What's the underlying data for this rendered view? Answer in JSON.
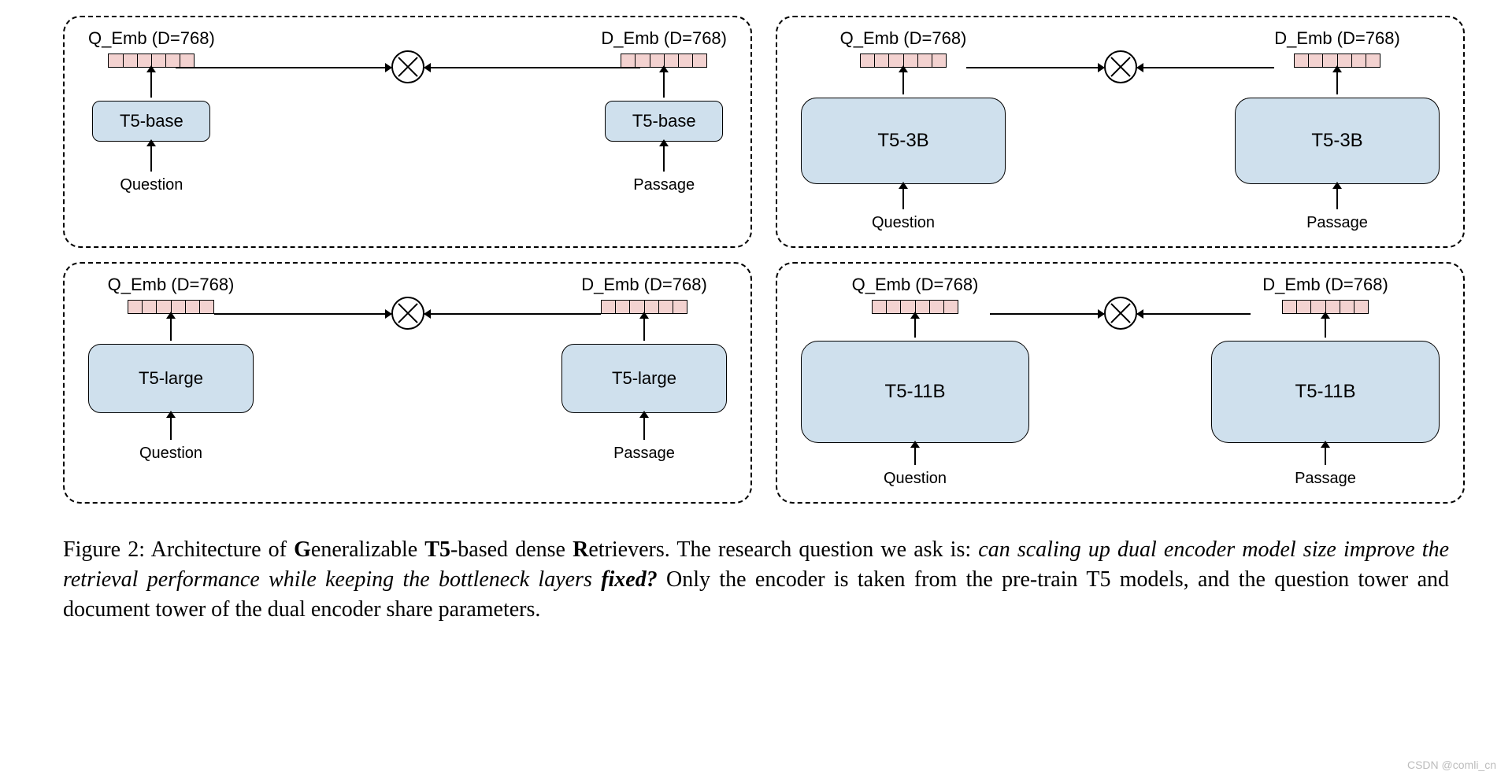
{
  "labels": {
    "q_emb": "Q_Emb (D=768)",
    "d_emb": "D_Emb (D=768)",
    "question": "Question",
    "passage": "Passage"
  },
  "panels": {
    "tl": {
      "model": "T5-base",
      "size": "sz-base"
    },
    "bl": {
      "model": "T5-large",
      "size": "sz-large"
    },
    "tr": {
      "model": "T5-3B",
      "size": "sz-3b"
    },
    "br": {
      "model": "T5-11B",
      "size": "sz-11b"
    }
  },
  "caption": {
    "prefix": "Figure 2: Architecture of ",
    "b1": "G",
    "t1": "eneralizable ",
    "b2": "T5",
    "t2": "-based dense ",
    "b3": "R",
    "t3": "etrievers. The research question we ask is: ",
    "italic1": "can scaling up dual encoder model size improve the retrieval performance while keeping the bottleneck layers ",
    "bolditalic": "fixed?",
    "rest": " Only the encoder is taken from the pre-train T5 models, and the question tower and document tower of the dual encoder share parameters."
  },
  "watermark": "CSDN @comli_cn"
}
